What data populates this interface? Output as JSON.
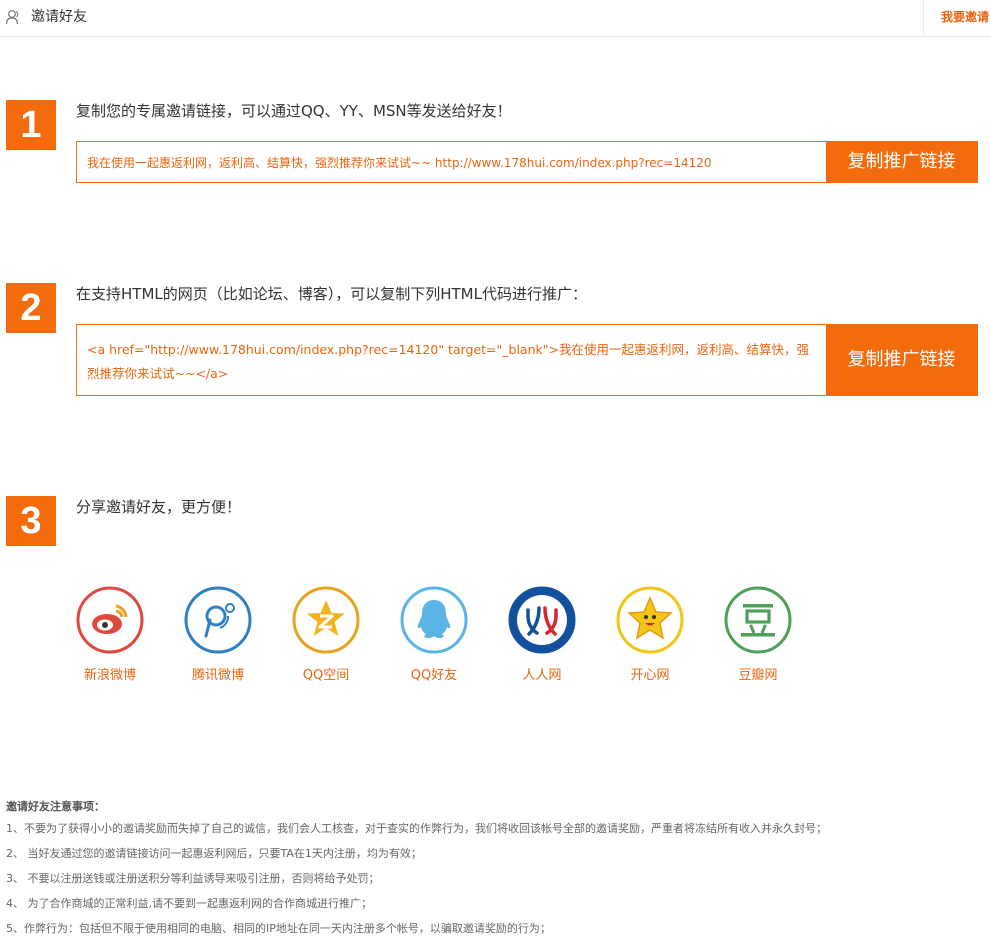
{
  "header": {
    "title": "邀请好友",
    "invite_link": "我要邀请"
  },
  "steps": [
    {
      "number": "1",
      "description": "复制您的专属邀请链接，可以通过QQ、YY、MSN等发送给好友！",
      "link": "我在使用一起惠返利网，返利高、结算快，强烈推荐你来试试~~ http://www.178hui.com/index.php?rec=14120",
      "button": "复制推广链接"
    },
    {
      "number": "2",
      "description": "在支持HTML的网页（比如论坛、博客），可以复制下列HTML代码进行推广：",
      "code": "<a href=\"http://www.178hui.com/index.php?rec=14120\" target=\"_blank\">我在使用一起惠返利网，返利高、结算快，强烈推荐你来试试~~</a>",
      "button": "复制推广链接"
    },
    {
      "number": "3",
      "description": "分享邀请好友，更方便！"
    }
  ],
  "share": [
    {
      "label": "新浪微博",
      "icon": "weibo-icon",
      "color": "#e0483e"
    },
    {
      "label": "腾讯微博",
      "icon": "tencent-weibo-icon",
      "color": "#2f7fc4"
    },
    {
      "label": "QQ空间",
      "icon": "qzone-icon",
      "color": "#e9a21b"
    },
    {
      "label": "QQ好友",
      "icon": "qq-icon",
      "color": "#5bb3e6"
    },
    {
      "label": "人人网",
      "icon": "renren-icon",
      "color": "#11519e"
    },
    {
      "label": "开心网",
      "icon": "kaixin-icon",
      "color": "#f2c413"
    },
    {
      "label": "豆瓣网",
      "icon": "douban-icon",
      "color": "#4f9f5a"
    }
  ],
  "notes": {
    "title": "邀请好友注意事项：",
    "items": [
      "1、不要为了获得小小的邀请奖励而失掉了自己的诚信，我们会人工核查，对于查实的作弊行为，我们将收回该帐号全部的邀请奖励，严重者将冻结所有收入并永久封号；",
      "2、 当好友通过您的邀请链接访问一起惠返利网后，只要TA在1天内注册，均为有效；",
      "3、 不要以注册送钱或注册送积分等利益诱导来吸引注册，否则将给予处罚；",
      "4、 为了合作商城的正常利益,请不要到一起惠返利网的合作商城进行推广；",
      "5、作弊行为：包括但不限于使用相同的电脑、相同的IP地址在同一天内注册多个帐号，以骗取邀请奖励的行为；"
    ]
  },
  "colors": {
    "accent": "#f26c0d",
    "accent_text": "#e8650f"
  }
}
